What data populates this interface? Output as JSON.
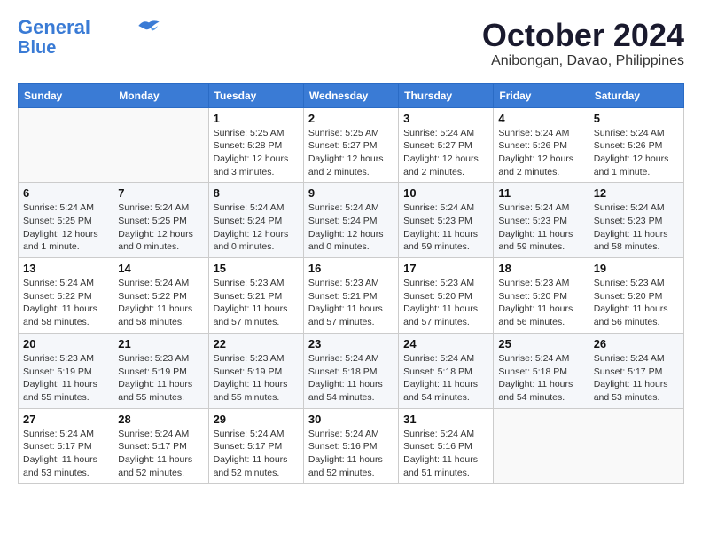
{
  "header": {
    "logo_line1": "General",
    "logo_line2": "Blue",
    "month": "October 2024",
    "location": "Anibongan, Davao, Philippines"
  },
  "weekdays": [
    "Sunday",
    "Monday",
    "Tuesday",
    "Wednesday",
    "Thursday",
    "Friday",
    "Saturday"
  ],
  "weeks": [
    [
      {
        "day": "",
        "info": ""
      },
      {
        "day": "",
        "info": ""
      },
      {
        "day": "1",
        "info": "Sunrise: 5:25 AM\nSunset: 5:28 PM\nDaylight: 12 hours and 3 minutes."
      },
      {
        "day": "2",
        "info": "Sunrise: 5:25 AM\nSunset: 5:27 PM\nDaylight: 12 hours and 2 minutes."
      },
      {
        "day": "3",
        "info": "Sunrise: 5:24 AM\nSunset: 5:27 PM\nDaylight: 12 hours and 2 minutes."
      },
      {
        "day": "4",
        "info": "Sunrise: 5:24 AM\nSunset: 5:26 PM\nDaylight: 12 hours and 2 minutes."
      },
      {
        "day": "5",
        "info": "Sunrise: 5:24 AM\nSunset: 5:26 PM\nDaylight: 12 hours and 1 minute."
      }
    ],
    [
      {
        "day": "6",
        "info": "Sunrise: 5:24 AM\nSunset: 5:25 PM\nDaylight: 12 hours and 1 minute."
      },
      {
        "day": "7",
        "info": "Sunrise: 5:24 AM\nSunset: 5:25 PM\nDaylight: 12 hours and 0 minutes."
      },
      {
        "day": "8",
        "info": "Sunrise: 5:24 AM\nSunset: 5:24 PM\nDaylight: 12 hours and 0 minutes."
      },
      {
        "day": "9",
        "info": "Sunrise: 5:24 AM\nSunset: 5:24 PM\nDaylight: 12 hours and 0 minutes."
      },
      {
        "day": "10",
        "info": "Sunrise: 5:24 AM\nSunset: 5:23 PM\nDaylight: 11 hours and 59 minutes."
      },
      {
        "day": "11",
        "info": "Sunrise: 5:24 AM\nSunset: 5:23 PM\nDaylight: 11 hours and 59 minutes."
      },
      {
        "day": "12",
        "info": "Sunrise: 5:24 AM\nSunset: 5:23 PM\nDaylight: 11 hours and 58 minutes."
      }
    ],
    [
      {
        "day": "13",
        "info": "Sunrise: 5:24 AM\nSunset: 5:22 PM\nDaylight: 11 hours and 58 minutes."
      },
      {
        "day": "14",
        "info": "Sunrise: 5:24 AM\nSunset: 5:22 PM\nDaylight: 11 hours and 58 minutes."
      },
      {
        "day": "15",
        "info": "Sunrise: 5:23 AM\nSunset: 5:21 PM\nDaylight: 11 hours and 57 minutes."
      },
      {
        "day": "16",
        "info": "Sunrise: 5:23 AM\nSunset: 5:21 PM\nDaylight: 11 hours and 57 minutes."
      },
      {
        "day": "17",
        "info": "Sunrise: 5:23 AM\nSunset: 5:20 PM\nDaylight: 11 hours and 57 minutes."
      },
      {
        "day": "18",
        "info": "Sunrise: 5:23 AM\nSunset: 5:20 PM\nDaylight: 11 hours and 56 minutes."
      },
      {
        "day": "19",
        "info": "Sunrise: 5:23 AM\nSunset: 5:20 PM\nDaylight: 11 hours and 56 minutes."
      }
    ],
    [
      {
        "day": "20",
        "info": "Sunrise: 5:23 AM\nSunset: 5:19 PM\nDaylight: 11 hours and 55 minutes."
      },
      {
        "day": "21",
        "info": "Sunrise: 5:23 AM\nSunset: 5:19 PM\nDaylight: 11 hours and 55 minutes."
      },
      {
        "day": "22",
        "info": "Sunrise: 5:23 AM\nSunset: 5:19 PM\nDaylight: 11 hours and 55 minutes."
      },
      {
        "day": "23",
        "info": "Sunrise: 5:24 AM\nSunset: 5:18 PM\nDaylight: 11 hours and 54 minutes."
      },
      {
        "day": "24",
        "info": "Sunrise: 5:24 AM\nSunset: 5:18 PM\nDaylight: 11 hours and 54 minutes."
      },
      {
        "day": "25",
        "info": "Sunrise: 5:24 AM\nSunset: 5:18 PM\nDaylight: 11 hours and 54 minutes."
      },
      {
        "day": "26",
        "info": "Sunrise: 5:24 AM\nSunset: 5:17 PM\nDaylight: 11 hours and 53 minutes."
      }
    ],
    [
      {
        "day": "27",
        "info": "Sunrise: 5:24 AM\nSunset: 5:17 PM\nDaylight: 11 hours and 53 minutes."
      },
      {
        "day": "28",
        "info": "Sunrise: 5:24 AM\nSunset: 5:17 PM\nDaylight: 11 hours and 52 minutes."
      },
      {
        "day": "29",
        "info": "Sunrise: 5:24 AM\nSunset: 5:17 PM\nDaylight: 11 hours and 52 minutes."
      },
      {
        "day": "30",
        "info": "Sunrise: 5:24 AM\nSunset: 5:16 PM\nDaylight: 11 hours and 52 minutes."
      },
      {
        "day": "31",
        "info": "Sunrise: 5:24 AM\nSunset: 5:16 PM\nDaylight: 11 hours and 51 minutes."
      },
      {
        "day": "",
        "info": ""
      },
      {
        "day": "",
        "info": ""
      }
    ]
  ]
}
